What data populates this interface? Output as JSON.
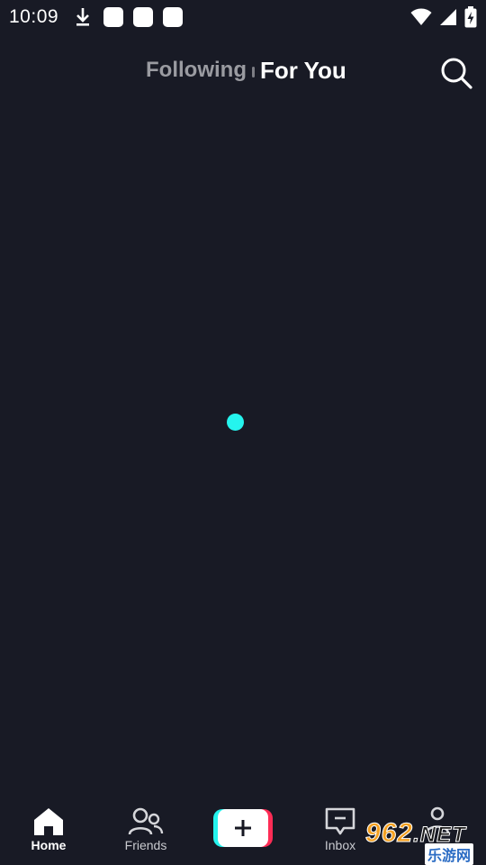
{
  "status_bar": {
    "time": "10:09",
    "icons": [
      "download-icon",
      "notification-square-icon",
      "notification-square-icon",
      "notification-square-icon",
      "wifi-icon",
      "cell-signal-icon",
      "battery-charging-icon"
    ]
  },
  "header": {
    "tab_following": "Following",
    "tab_for_you": "For You",
    "active_tab": "For You",
    "search_icon": "search-icon"
  },
  "content": {
    "loading_color": "#25f4ee"
  },
  "bottom_nav": {
    "items": [
      {
        "label": "Home",
        "icon": "home-icon",
        "active": true
      },
      {
        "label": "Friends",
        "icon": "friends-icon",
        "active": false
      },
      {
        "label": "",
        "icon": "plus-icon",
        "active": false
      },
      {
        "label": "Inbox",
        "icon": "inbox-icon",
        "active": false
      },
      {
        "label": "",
        "icon": "profile-icon",
        "active": false
      }
    ]
  },
  "watermark": {
    "brand": "962",
    "suffix": ".NET",
    "sub": "乐游网"
  },
  "colors": {
    "background": "#181a25",
    "accent_cyan": "#25f4ee",
    "accent_red": "#fe2c55"
  }
}
